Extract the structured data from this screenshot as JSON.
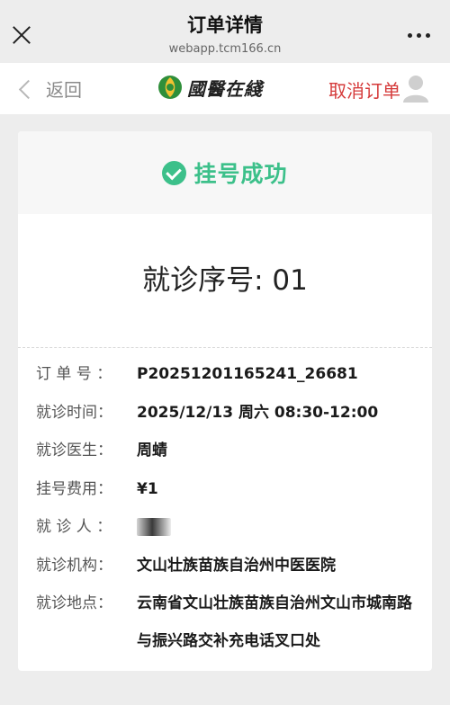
{
  "titlebar": {
    "title": "订单详情",
    "domain": "webapp.tcm166.cn"
  },
  "navbar": {
    "back_label": "返回",
    "logo_text": "國醫在綫",
    "cancel_label": "取消订单"
  },
  "card": {
    "success_text": "挂号成功",
    "queue_number": "就诊序号: 01",
    "rows": [
      {
        "label": "订 单 号 ：",
        "value": "P20251201165241_26681"
      },
      {
        "label": "就诊时间：",
        "value": "2025/12/13 周六 08:30-12:00"
      },
      {
        "label": "就诊医生：",
        "value": "周蜻"
      },
      {
        "label": "挂号费用：",
        "value": "¥1"
      },
      {
        "label": "就 诊 人 ：",
        "value": ""
      },
      {
        "label": "就诊机构：",
        "value": "文山壮族苗族自治州中医医院"
      },
      {
        "label": "就诊地点：",
        "value": "云南省文山壮族苗族自治州文山市城南路与振兴路交补充电话叉口处"
      }
    ]
  },
  "colors": {
    "success_green": "#3cc08a",
    "cancel_red": "#d53a3a",
    "background": "#ededed"
  },
  "icons": [
    "close-icon",
    "more-icon",
    "back-chevron-icon",
    "logo-icon",
    "user-avatar-icon",
    "check-circle-icon"
  ]
}
